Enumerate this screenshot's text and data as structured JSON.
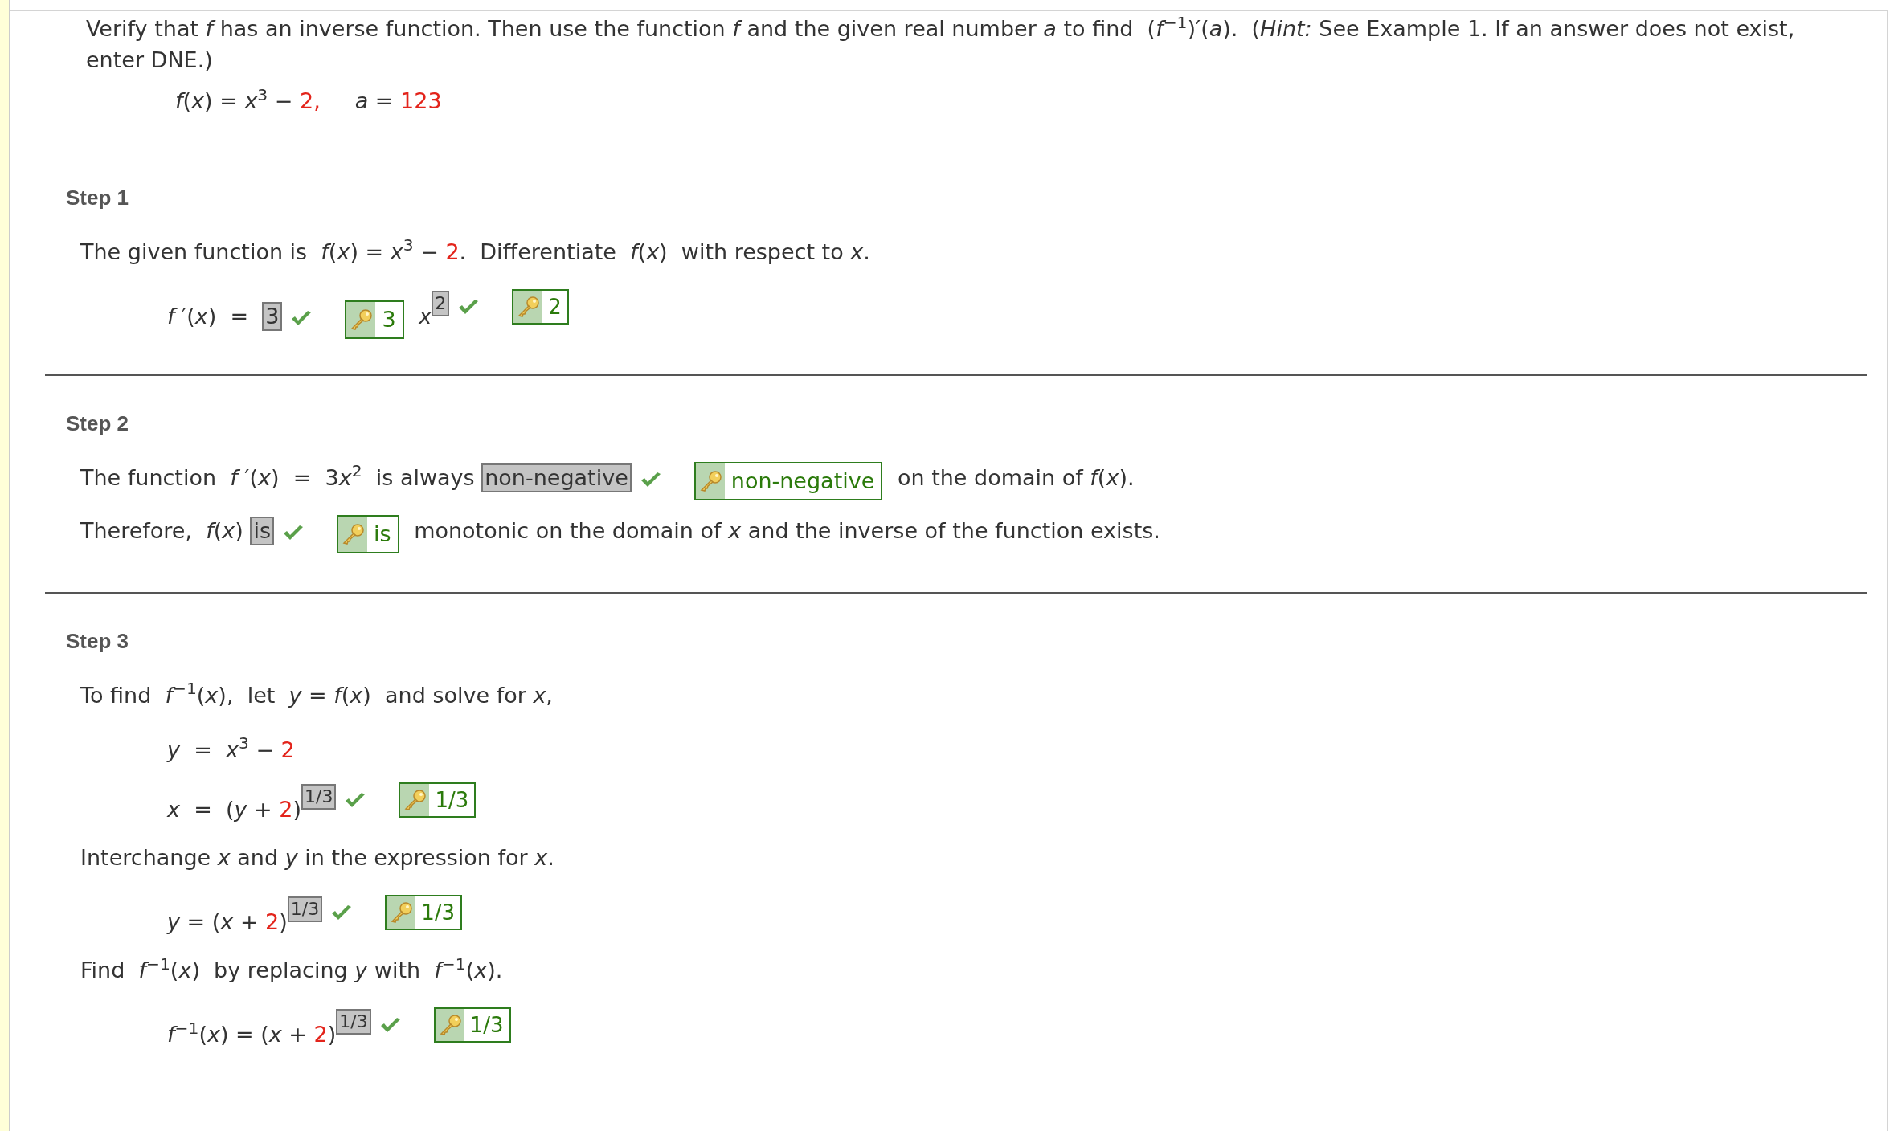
{
  "question": {
    "text": "Verify that *f* has an inverse function. Then use the function *f* and the given real number *a* to find  (*f*$^{−1}$)′(*a*).  (*Hint:* See Example 1. If an answer does not exist, enter DNE.)",
    "given": [
      {
        "kind": "text",
        "text": "*f*(*x*) = *x*$^{3}$ − "
      },
      {
        "kind": "given",
        "text": "2,"
      },
      {
        "kind": "text",
        "text": "     *a* = "
      },
      {
        "kind": "given",
        "text": "123"
      }
    ]
  },
  "steps": [
    {
      "title": "Step 1",
      "lines": [
        {
          "kind": "prose",
          "parts": [
            {
              "kind": "text",
              "text": "The given function is  *f*(*x*) = *x*$^{3}$ − "
            },
            {
              "kind": "given",
              "text": "2"
            },
            {
              "kind": "text",
              "text": ".  Differentiate  *f*(*x*)  with respect to *x*."
            }
          ]
        },
        {
          "kind": "equation",
          "parts": [
            {
              "kind": "text",
              "text": "*f* ′(*x*)  =  "
            },
            {
              "kind": "answer",
              "text": "3",
              "correct": true,
              "raised": false
            },
            {
              "kind": "key",
              "text": "3",
              "raised": false
            },
            {
              "kind": "text",
              "text": " *x*"
            },
            {
              "kind": "answer",
              "text": "2",
              "correct": true,
              "raised": true
            },
            {
              "kind": "key",
              "text": "2",
              "raised": true
            }
          ]
        }
      ]
    },
    {
      "title": "Step 2",
      "lines": [
        {
          "kind": "prose",
          "parts": [
            {
              "kind": "text",
              "text": "The function  *f* ′(*x*)  =  3"
            },
            {
              "kind": "text",
              "text": "*x*$^{2}$  is always "
            },
            {
              "kind": "answer",
              "text": "non-negative",
              "correct": true,
              "raised": false
            },
            {
              "kind": "key",
              "text": "non-negative",
              "raised": false
            },
            {
              "kind": "text",
              "text": " on the domain of *f*(*x*)."
            }
          ]
        },
        {
          "kind": "prose",
          "parts": [
            {
              "kind": "text",
              "text": "Therefore,  *f*(*x*) "
            },
            {
              "kind": "answer",
              "text": "is",
              "correct": true,
              "raised": false
            },
            {
              "kind": "key",
              "text": "is",
              "raised": false
            },
            {
              "kind": "text",
              "text": " monotonic on the domain of *x* and the inverse of the function exists."
            }
          ]
        }
      ]
    },
    {
      "title": "Step 3",
      "lines": [
        {
          "kind": "prose",
          "parts": [
            {
              "kind": "text",
              "text": "To find  *f*$^{−1}$(*x*),  let  *y* = *f*(*x*)  and solve for *x*,"
            }
          ]
        },
        {
          "kind": "equation",
          "parts": [
            {
              "kind": "text",
              "text": "*y*  =  *x*$^{3}$ − "
            },
            {
              "kind": "given",
              "text": "2"
            }
          ]
        },
        {
          "kind": "equation",
          "parts": [
            {
              "kind": "text",
              "text": "*x*  =  (*y* + "
            },
            {
              "kind": "given",
              "text": "2"
            },
            {
              "kind": "text",
              "text": ")"
            },
            {
              "kind": "answer",
              "text": "1/3",
              "correct": true,
              "raised": true
            },
            {
              "kind": "key",
              "text": "1/3",
              "raised": true
            }
          ]
        },
        {
          "kind": "prose",
          "parts": [
            {
              "kind": "text",
              "text": "Interchange *x* and *y* in the expression for *x*."
            }
          ]
        },
        {
          "kind": "equation",
          "parts": [
            {
              "kind": "text",
              "text": "*y* = (*x* + "
            },
            {
              "kind": "given",
              "text": "2"
            },
            {
              "kind": "text",
              "text": ")"
            },
            {
              "kind": "answer",
              "text": "1/3",
              "correct": true,
              "raised": true
            },
            {
              "kind": "key",
              "text": "1/3",
              "raised": true
            }
          ]
        },
        {
          "kind": "prose",
          "parts": [
            {
              "kind": "text",
              "text": "Find  *f*$^{−1}$(*x*)  by replacing *y* with  *f*$^{−1}$(*x*)."
            }
          ]
        },
        {
          "kind": "equation",
          "parts": [
            {
              "kind": "text",
              "text": "*f*$^{−1}$(*x*) = (*x* + "
            },
            {
              "kind": "given",
              "text": "2"
            },
            {
              "kind": "text",
              "text": ")"
            },
            {
              "kind": "answer",
              "text": "1/3",
              "correct": true,
              "raised": true
            },
            {
              "kind": "key",
              "text": "1/3",
              "raised": true
            }
          ]
        }
      ]
    }
  ]
}
